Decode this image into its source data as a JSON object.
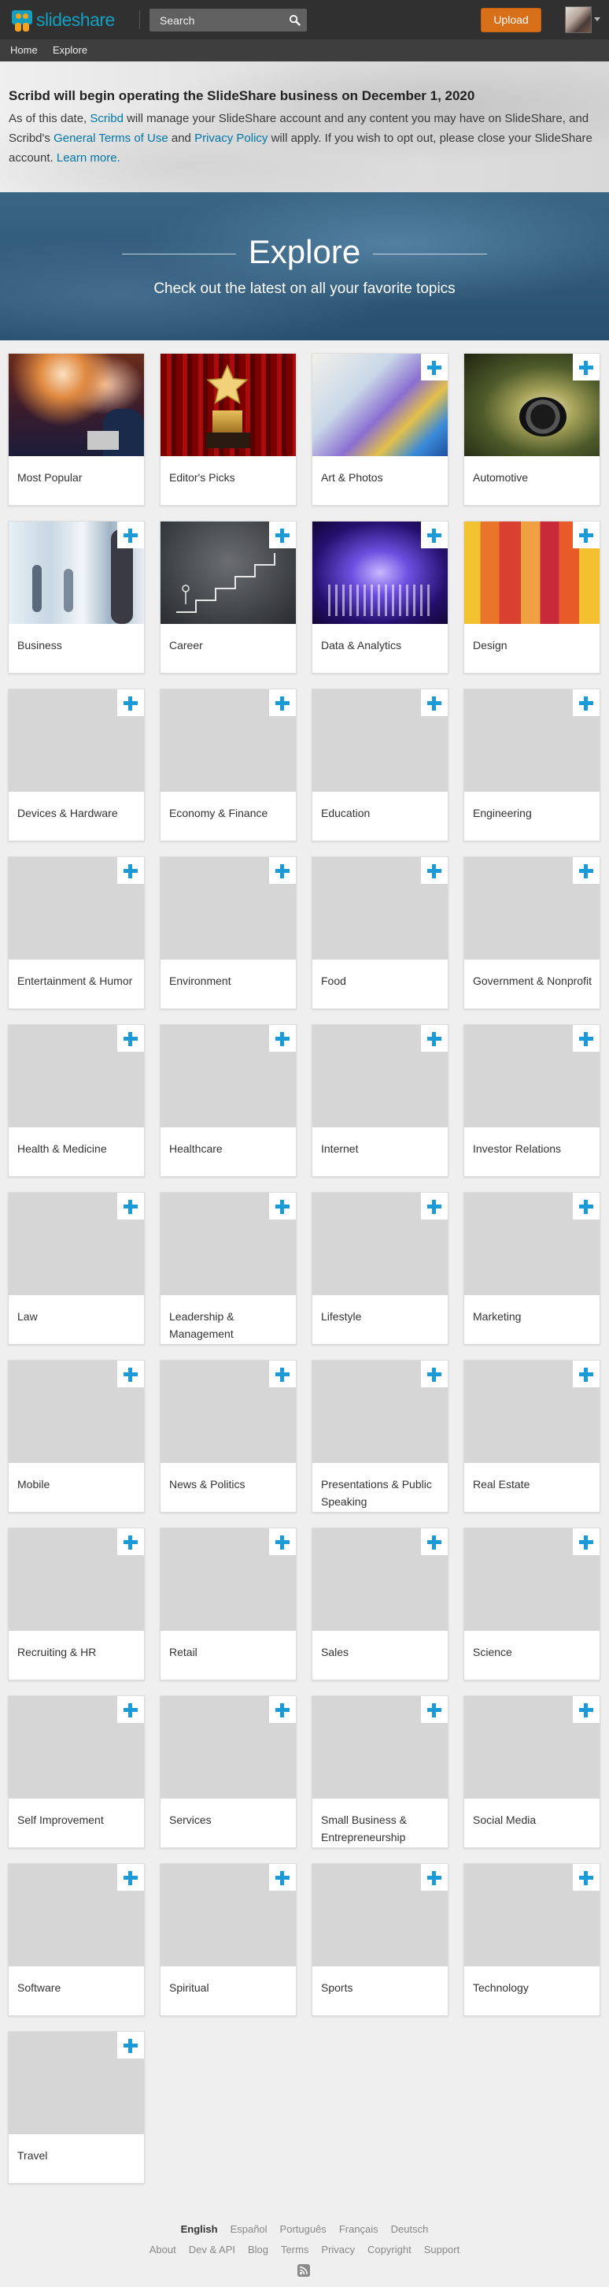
{
  "header": {
    "logo_text": "slideshare",
    "search_placeholder": "Search",
    "upload_label": "Upload",
    "colors": {
      "bar": "#303030",
      "brand": "#13a0c0",
      "upload": "#d8701a"
    }
  },
  "subnav": {
    "items": [
      "Home",
      "Explore"
    ]
  },
  "notice": {
    "title": "Scribd will begin operating the SlideShare business on December 1, 2020",
    "p1": "As of this date, ",
    "link_scribd": "Scribd",
    "p2": " will manage your SlideShare account and any content you may have on SlideShare, and Scribd's ",
    "link_terms": "General Terms of Use",
    "p3": " and ",
    "link_privacy": "Privacy Policy",
    "p4": " will apply. If you wish to opt out, please close your SlideShare account. ",
    "link_learn": "Learn more."
  },
  "hero": {
    "title": "Explore",
    "subtitle": "Check out the latest on all your favorite topics"
  },
  "topics": [
    {
      "label": "Most Popular",
      "icon": "conference-photo",
      "plus": false
    },
    {
      "label": "Editor's Picks",
      "icon": "star-trophy-photo",
      "plus": false
    },
    {
      "label": "Art & Photos",
      "icon": "paintbrush-photo",
      "plus": true
    },
    {
      "label": "Automotive",
      "icon": "car-motion-photo",
      "plus": true
    },
    {
      "label": "Business",
      "icon": "office-people-photo",
      "plus": true
    },
    {
      "label": "Career",
      "icon": "chalk-stairs-photo",
      "plus": true
    },
    {
      "label": "Data & Analytics",
      "icon": "data-bars-photo",
      "plus": true
    },
    {
      "label": "Design",
      "icon": "color-bars-photo",
      "plus": true
    },
    {
      "label": "Devices & Hardware",
      "icon": "",
      "plus": true
    },
    {
      "label": "Economy & Finance",
      "icon": "",
      "plus": true
    },
    {
      "label": "Education",
      "icon": "",
      "plus": true
    },
    {
      "label": "Engineering",
      "icon": "",
      "plus": true
    },
    {
      "label": "Entertainment & Humor",
      "icon": "",
      "plus": true
    },
    {
      "label": "Environment",
      "icon": "",
      "plus": true
    },
    {
      "label": "Food",
      "icon": "",
      "plus": true
    },
    {
      "label": "Government & Nonprofit",
      "icon": "",
      "plus": true
    },
    {
      "label": "Health & Medicine",
      "icon": "",
      "plus": true
    },
    {
      "label": "Healthcare",
      "icon": "",
      "plus": true
    },
    {
      "label": "Internet",
      "icon": "",
      "plus": true
    },
    {
      "label": "Investor Relations",
      "icon": "",
      "plus": true
    },
    {
      "label": "Law",
      "icon": "",
      "plus": true
    },
    {
      "label": "Leadership & Management",
      "icon": "",
      "plus": true
    },
    {
      "label": "Lifestyle",
      "icon": "",
      "plus": true
    },
    {
      "label": "Marketing",
      "icon": "",
      "plus": true
    },
    {
      "label": "Mobile",
      "icon": "",
      "plus": true
    },
    {
      "label": "News & Politics",
      "icon": "",
      "plus": true
    },
    {
      "label": "Presentations & Public Speaking",
      "icon": "",
      "plus": true
    },
    {
      "label": "Real Estate",
      "icon": "",
      "plus": true
    },
    {
      "label": "Recruiting & HR",
      "icon": "",
      "plus": true
    },
    {
      "label": "Retail",
      "icon": "",
      "plus": true
    },
    {
      "label": "Sales",
      "icon": "",
      "plus": true
    },
    {
      "label": "Science",
      "icon": "",
      "plus": true
    },
    {
      "label": "Self Improvement",
      "icon": "",
      "plus": true
    },
    {
      "label": "Services",
      "icon": "",
      "plus": true
    },
    {
      "label": "Small Business & Entrepreneurship",
      "icon": "",
      "plus": true
    },
    {
      "label": "Social Media",
      "icon": "",
      "plus": true
    },
    {
      "label": "Software",
      "icon": "",
      "plus": true
    },
    {
      "label": "Spiritual",
      "icon": "",
      "plus": true
    },
    {
      "label": "Sports",
      "icon": "",
      "plus": true
    },
    {
      "label": "Technology",
      "icon": "",
      "plus": true
    },
    {
      "label": "Travel",
      "icon": "",
      "plus": true
    }
  ],
  "footer": {
    "languages": [
      "English",
      "Español",
      "Português",
      "Français",
      "Deutsch"
    ],
    "active_language": "English",
    "links": [
      "About",
      "Dev & API",
      "Blog",
      "Terms",
      "Privacy",
      "Copyright",
      "Support"
    ]
  }
}
